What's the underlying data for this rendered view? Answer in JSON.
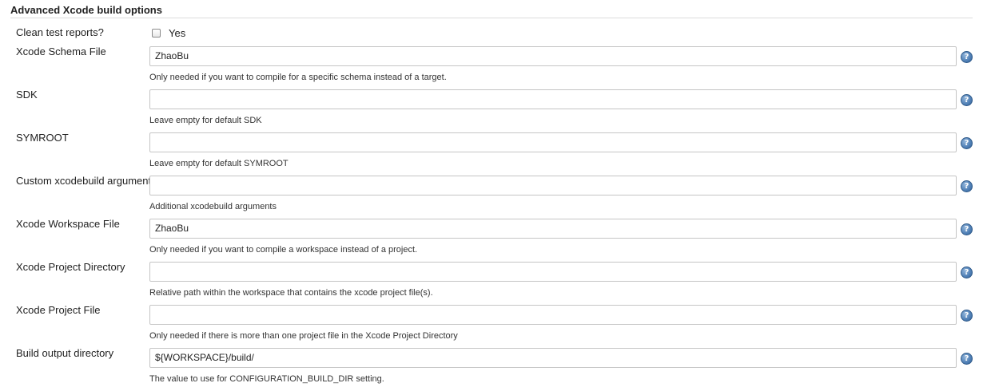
{
  "section": {
    "title": "Advanced Xcode build options"
  },
  "clean_test_reports": {
    "label": "Clean test reports?",
    "checkbox_label": "Yes",
    "checked": false
  },
  "help_glyph": "?",
  "fields": [
    {
      "label": "Xcode Schema File",
      "value": "ZhaoBu",
      "help": "Only needed if you want to compile for a specific schema instead of a target."
    },
    {
      "label": "SDK",
      "value": "",
      "help": "Leave empty for default SDK"
    },
    {
      "label": "SYMROOT",
      "value": "",
      "help": "Leave empty for default SYMROOT"
    },
    {
      "label": "Custom xcodebuild arguments",
      "value": "",
      "help": "Additional xcodebuild arguments"
    },
    {
      "label": "Xcode Workspace File",
      "value": "ZhaoBu",
      "help": "Only needed if you want to compile a workspace instead of a project."
    },
    {
      "label": "Xcode Project Directory",
      "value": "",
      "help": "Relative path within the workspace that contains the xcode project file(s)."
    },
    {
      "label": "Xcode Project File",
      "value": "",
      "help": "Only needed if there is more than one project file in the Xcode Project Directory"
    },
    {
      "label": "Build output directory",
      "value": "${WORKSPACE}/build/",
      "help": "The value to use for CONFIGURATION_BUILD_DIR setting."
    }
  ]
}
